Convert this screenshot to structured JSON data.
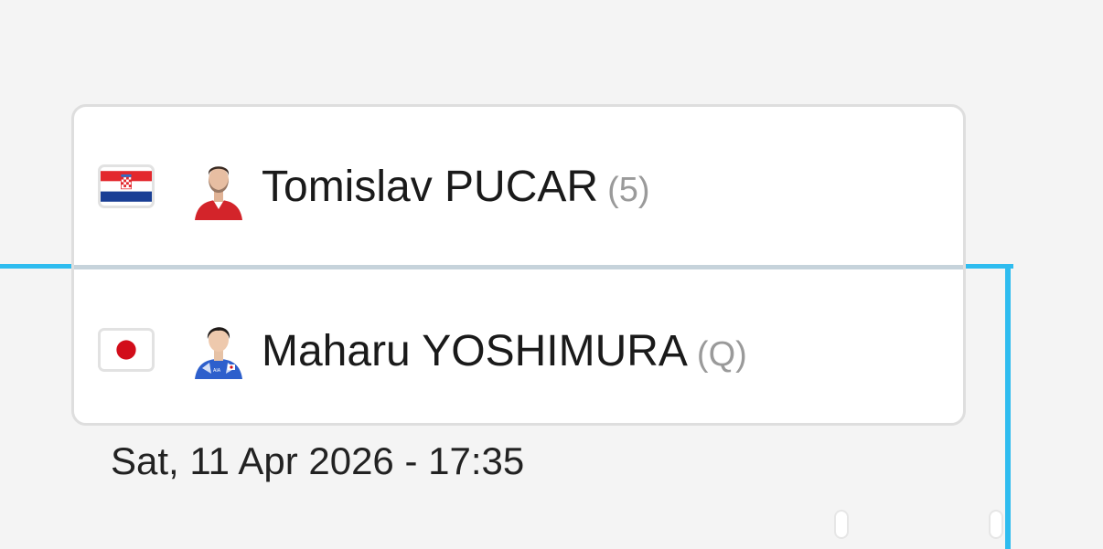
{
  "match": {
    "player1": {
      "name": "Tomislav PUCAR",
      "seed": "(5)",
      "country_flag": "croatia-flag",
      "flag_colors": [
        "#e3282d",
        "#ffffff",
        "#1a3f95"
      ]
    },
    "player2": {
      "name": "Maharu YOSHIMURA",
      "seed": "(Q)",
      "country_flag": "japan-flag",
      "flag_colors": [
        "#ffffff",
        "#d20d1a"
      ]
    },
    "datetime": "Sat, 11 Apr 2026 - 17:35"
  },
  "colors": {
    "bracket_line": "#2ebcef",
    "background": "#f4f4f4",
    "card_border": "#dedede"
  }
}
